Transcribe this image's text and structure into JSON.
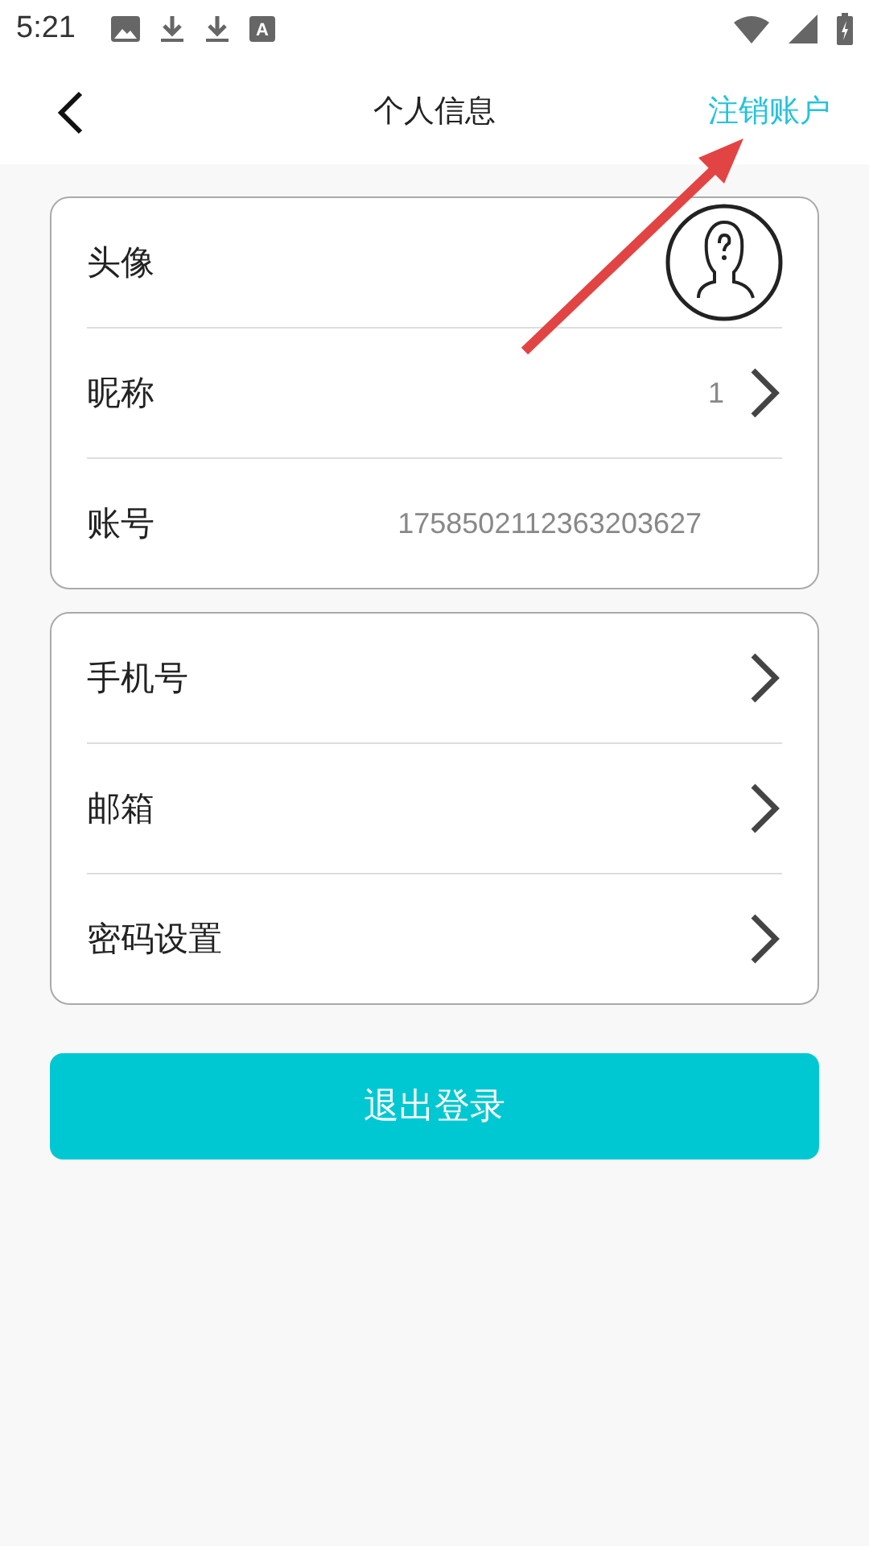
{
  "status_bar": {
    "time": "5:21",
    "input_icon_letter": "A"
  },
  "header": {
    "title": "个人信息",
    "action": "注销账户"
  },
  "groups": [
    {
      "rows": [
        {
          "kind": "avatar",
          "label": "头像"
        },
        {
          "kind": "link",
          "label": "昵称",
          "value": "1"
        },
        {
          "kind": "info",
          "label": "账号",
          "value": "1758502112363203627"
        }
      ]
    },
    {
      "rows": [
        {
          "kind": "link",
          "label": "手机号"
        },
        {
          "kind": "link",
          "label": "邮箱"
        },
        {
          "kind": "link",
          "label": "密码设置"
        }
      ]
    }
  ],
  "logout_button": "退出登录"
}
